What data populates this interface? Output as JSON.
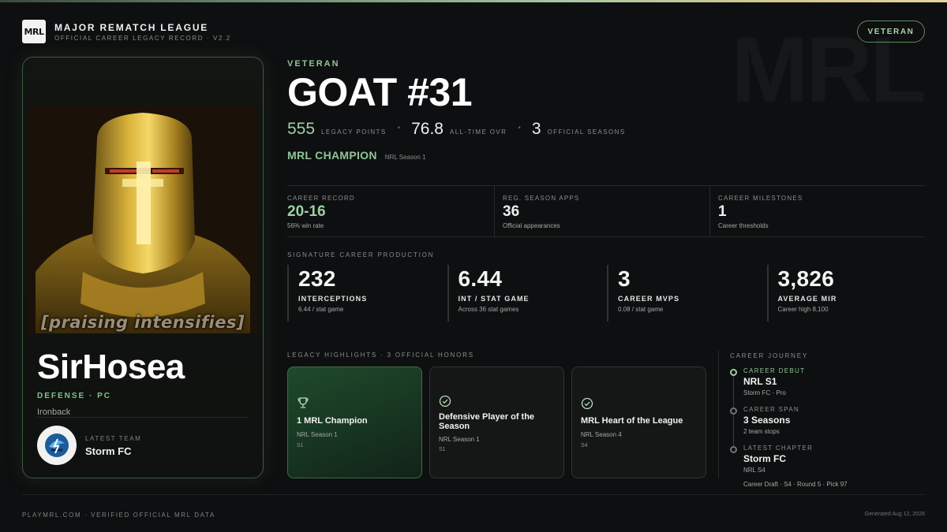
{
  "header": {
    "logo_text": "MRL",
    "league_name": "MAJOR REMATCH LEAGUE",
    "league_sub": "OFFICIAL CAREER LEGACY RECORD · V2.2",
    "tier_pill": "VETERAN",
    "watermark": "MRL"
  },
  "player": {
    "portrait_caption": "[praising intensifies]",
    "name": "SirHosea",
    "position": "DEFENSE · PC",
    "title": "Ironback",
    "team_caption": "LATEST TEAM",
    "team_name": "Storm FC"
  },
  "hero": {
    "eyebrow": "VETERAN",
    "title": "GOAT #31",
    "legacy_points": "555",
    "legacy_points_label": "LEGACY POINTS",
    "ovr": "76.8",
    "ovr_label": "ALL-TIME OVR",
    "seasons": "3",
    "seasons_label": "OFFICIAL SEASONS",
    "dot": "•",
    "champion": "MRL CHAMPION",
    "champion_sub": "NRL Season 1"
  },
  "record": [
    {
      "label": "CAREER RECORD",
      "value": "20-16",
      "sub": "56% win rate"
    },
    {
      "label": "REG. SEASON APPS",
      "value": "36",
      "sub": "Official appearances"
    },
    {
      "label": "CAREER MILESTONES",
      "value": "1",
      "sub": "Career thresholds"
    }
  ],
  "production": {
    "label": "SIGNATURE CAREER PRODUCTION",
    "items": [
      {
        "value": "232",
        "label": "INTERCEPTIONS",
        "sub": "6.44 / stat game"
      },
      {
        "value": "6.44",
        "label": "INT / STAT GAME",
        "sub": "Across 36 stat games"
      },
      {
        "value": "3",
        "label": "CAREER MVPS",
        "sub": "0.08 / stat game"
      },
      {
        "value": "3,826",
        "label": "AVERAGE MIR",
        "sub": "Career high 8,100"
      }
    ]
  },
  "honors": {
    "label": "LEGACY HIGHLIGHTS · 3 OFFICIAL HONORS",
    "items": [
      {
        "icon": "trophy-icon",
        "title": "1 MRL Champion",
        "season": "NRL Season 1",
        "tag": "S1"
      },
      {
        "icon": "check-circle-icon",
        "title": "Defensive Player of the Season",
        "season": "NRL Season 1",
        "tag": "S1"
      },
      {
        "icon": "check-circle-icon",
        "title": "MRL Heart of the League",
        "season": "NRL Season 4",
        "tag": "S4"
      }
    ]
  },
  "journey": {
    "label": "CAREER JOURNEY",
    "steps": [
      {
        "caption": "CAREER DEBUT",
        "title": "NRL S1",
        "sub": "Storm FC · Pro"
      },
      {
        "caption": "CAREER SPAN",
        "title": "3 Seasons",
        "sub": "2 team stops"
      },
      {
        "caption": "LATEST CHAPTER",
        "title": "Storm FC",
        "sub": "NRL S4"
      }
    ],
    "draft": "Career Draft · S4 · Round 5 · Pick 97"
  },
  "footer": {
    "left": "PLAYMRL.COM · VERIFIED OFFICIAL MRL DATA",
    "right": "Generated Aug 12, 2026"
  },
  "colors": {
    "accent_green": "#8ec596",
    "background": "#0e0f10",
    "featured_card": "#1f4a2b"
  }
}
